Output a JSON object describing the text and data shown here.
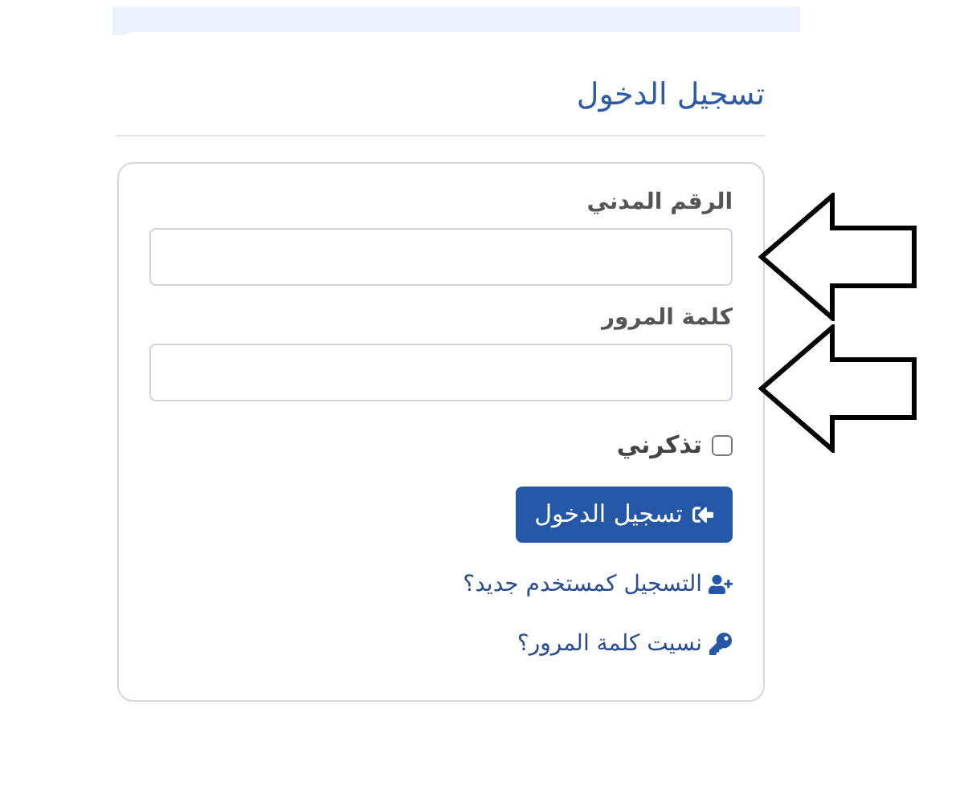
{
  "title": "تسجيل الدخول",
  "fields": [
    {
      "label": "الرقم المدني"
    },
    {
      "label": "كلمة المرور"
    }
  ],
  "remember": {
    "label": "تذكرني",
    "checked": false
  },
  "submit": {
    "label": "تسجيل الدخول"
  },
  "links": [
    {
      "kind": "register",
      "label": "التسجيل كمستخدم جديد؟"
    },
    {
      "kind": "forgot",
      "label": "نسيت كلمة المرور؟"
    }
  ],
  "annotations": [
    {
      "kind": "arrow"
    },
    {
      "kind": "arrow"
    }
  ]
}
